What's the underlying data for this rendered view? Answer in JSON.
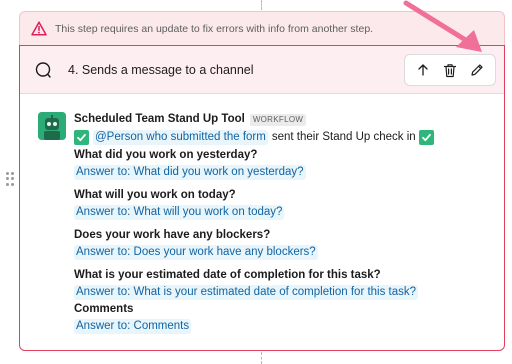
{
  "warning": {
    "text": "This step requires an update to fix errors with info from another step.",
    "icon": "warning-triangle-icon",
    "color": "#e01e5a"
  },
  "step": {
    "title": "4. Sends a message to a channel",
    "icon": "chat-bubble-icon",
    "toolbar": {
      "move_up_icon": "arrow-up-icon",
      "delete_icon": "trash-icon",
      "edit_icon": "pencil-icon"
    }
  },
  "message": {
    "sender": "Scheduled Team Stand Up Tool",
    "badge": "WORKFLOW",
    "mention": "@Person who submitted the form",
    "mention_suffix": "sent their Stand Up check in",
    "questions": [
      {
        "question": "What did you work on yesterday?",
        "answer": "Answer to: What did you work on yesterday?"
      },
      {
        "question": "What will you work on today?",
        "answer": "Answer to: What will you work on today?"
      },
      {
        "question": "Does your work have any blockers?",
        "answer": "Answer to: Does your work have any blockers?"
      },
      {
        "question": "What is your estimated date of completion for this task?",
        "answer": "Answer to: What is your estimated date of completion for this task?"
      },
      {
        "question": "Comments",
        "answer": "Answer to: Comments"
      }
    ]
  },
  "colors": {
    "error_border": "#e0405e",
    "link": "#1264a3",
    "annotation_arrow": "#f0709a"
  }
}
